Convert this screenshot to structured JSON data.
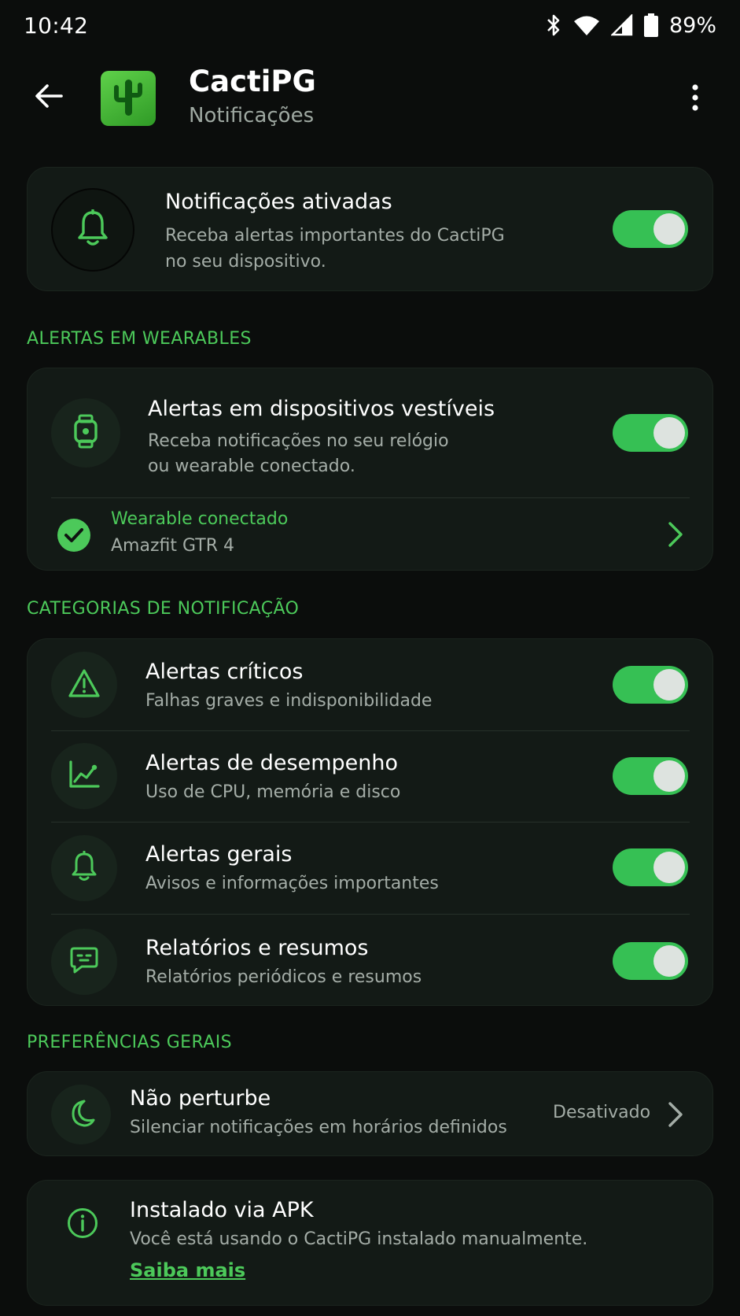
{
  "status_bar": {
    "time": "10:42",
    "battery": "89%",
    "icons": [
      "bluetooth-icon",
      "wifi-icon",
      "signal-icon",
      "battery-icon"
    ]
  },
  "app_bar": {
    "title": "CactiPG",
    "subtitle": "Notificações",
    "icons": [
      "back-arrow-icon",
      "cactus-logo-icon",
      "more-vert-icon"
    ]
  },
  "main_toggle": {
    "title": "Notificações ativadas",
    "description_line1": "Receba alertas importantes do CactiPG",
    "description_line2": "no seu dispositivo.",
    "enabled": true,
    "icon": "bell-icon"
  },
  "wearables": {
    "header": "ALERTAS EM WEARABLES",
    "toggle": {
      "title": "Alertas em dispositivos vestíveis",
      "description_line1": "Receba notificações no seu relógio",
      "description_line2": "ou wearable conectado.",
      "enabled": true,
      "icon": "watch-icon"
    },
    "connected": {
      "label": "Wearable conectado",
      "device": "Amazfit GTR 4",
      "icon": "check-circle-icon"
    }
  },
  "categories": {
    "header": "CATEGORIAS DE NOTIFICAÇÃO",
    "items": [
      {
        "title": "Alertas críticos",
        "subtitle": "Falhas graves e indisponibilidade",
        "enabled": true,
        "icon": "warning-icon"
      },
      {
        "title": "Alertas de desempenho",
        "subtitle": "Uso de CPU, memória e disco",
        "enabled": true,
        "icon": "chart-icon"
      },
      {
        "title": "Alertas gerais",
        "subtitle": "Avisos e informações importantes",
        "enabled": true,
        "icon": "bell-icon"
      },
      {
        "title": "Relatórios e resumos",
        "subtitle": "Relatórios periódicos e resumos",
        "enabled": true,
        "icon": "message-icon"
      }
    ]
  },
  "preferences": {
    "header": "PREFERÊNCIAS GERAIS",
    "dnd": {
      "title": "Não perturbe",
      "subtitle": "Silenciar notificações em horários definidos",
      "value": "Desativado",
      "icon": "moon-icon"
    }
  },
  "apk_info": {
    "title": "Instalado via APK",
    "text": "Você está usando o CactiPG instalado manualmente.",
    "link": "Saiba mais",
    "icon": "info-icon"
  },
  "colors": {
    "accent": "#4cc95a",
    "toggle_on": "#36c054",
    "background": "#0b0d0c",
    "card": "#131a16"
  }
}
